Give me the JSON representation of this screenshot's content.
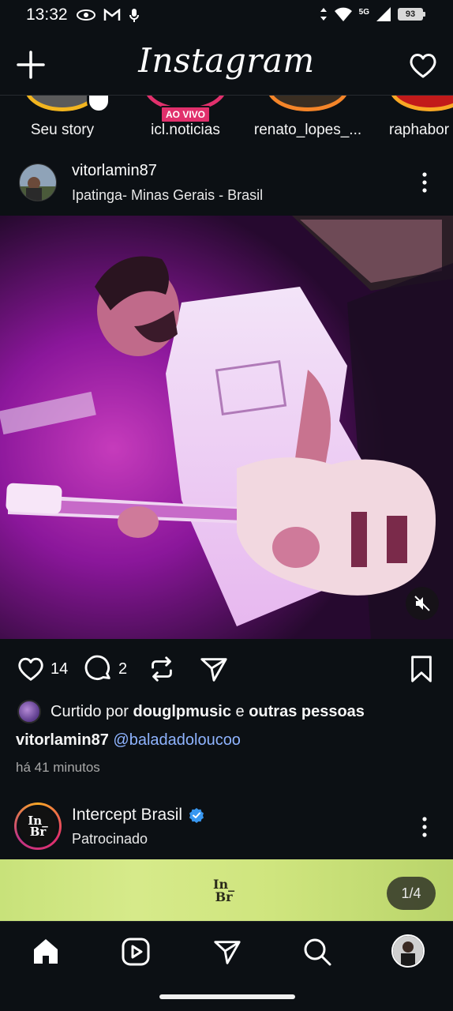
{
  "status_bar": {
    "time": "13:32",
    "network": "5G",
    "battery": "93"
  },
  "header": {
    "logo": "Instagram"
  },
  "stories": [
    {
      "label": "Seu story"
    },
    {
      "label": "icl.noticias",
      "badge": "AO VIVO"
    },
    {
      "label": "renato_lopes_..."
    },
    {
      "label": "raphabor"
    }
  ],
  "post": {
    "username": "vitorlamin87",
    "location": "Ipatinga- Minas Gerais - Brasil",
    "likes_count": "14",
    "comments_count": "2",
    "liked_by_prefix": "Curtido por",
    "liked_by_user": "douglpmusic",
    "liked_by_joiner": "e",
    "liked_by_others": "outras pessoas",
    "caption_user": "vitorlamin87",
    "caption_mention": "@baladadoloucoo",
    "time_ago": "há 41 minutos"
  },
  "sponsored": {
    "name": "Intercept Brasil",
    "subtitle": "Patrocinado",
    "logo_line1": "In_",
    "logo_line2": "Br",
    "carousel_counter": "1/4"
  },
  "colors": {
    "background": "#0c1014",
    "mention": "#8fb4ff",
    "live": "#e1306c",
    "verified": "#3897f0"
  }
}
